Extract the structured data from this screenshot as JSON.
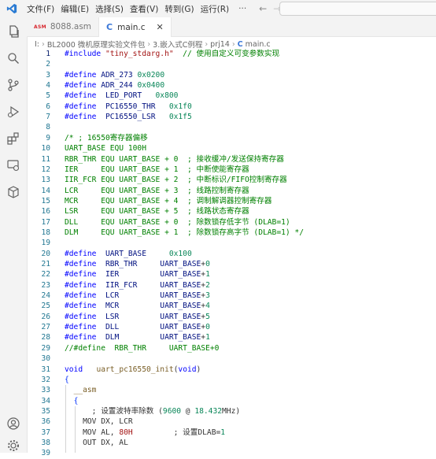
{
  "menu": [
    "文件(F)",
    "编辑(E)",
    "选择(S)",
    "查看(V)",
    "转到(G)",
    "运行(R)",
    "···"
  ],
  "tabs": [
    {
      "label": "8088.asm",
      "badge": "ASM",
      "active": false
    },
    {
      "label": "main.c",
      "badge": "C",
      "active": true
    }
  ],
  "breadcrumb": [
    "I:",
    "BL2000 微机原理实验文件包",
    "3.嵌入式C例程",
    "prj14",
    "main.c"
  ],
  "breadcrumb_file_badge": "C",
  "editor": {
    "lines": [
      {
        "n": "1",
        "t": [
          [
            "def",
            "#include "
          ],
          [
            "str",
            "\"tiny_stdarg.h\""
          ],
          [
            "cm",
            "  // 使用自定义可变参数实现"
          ]
        ]
      },
      {
        "n": "2",
        "t": []
      },
      {
        "n": "3",
        "t": [
          [
            "def",
            "#define "
          ],
          [
            "id",
            "ADR_273 "
          ],
          [
            "num",
            "0x0200"
          ]
        ]
      },
      {
        "n": "4",
        "t": [
          [
            "def",
            "#define "
          ],
          [
            "id",
            "ADR_244 "
          ],
          [
            "num",
            "0x0400"
          ]
        ]
      },
      {
        "n": "5",
        "t": [
          [
            "def",
            "#define  "
          ],
          [
            "id",
            "LED_PORT   "
          ],
          [
            "num",
            "0x800"
          ]
        ]
      },
      {
        "n": "6",
        "t": [
          [
            "def",
            "#define  "
          ],
          [
            "id",
            "PC16550_THR   "
          ],
          [
            "num",
            "0x1f0"
          ]
        ]
      },
      {
        "n": "7",
        "t": [
          [
            "def",
            "#define  "
          ],
          [
            "id",
            "PC16550_LSR   "
          ],
          [
            "num",
            "0x1f5"
          ]
        ]
      },
      {
        "n": "8",
        "t": []
      },
      {
        "n": "9",
        "t": [
          [
            "cm",
            "/* ; 16550寄存器偏移"
          ]
        ]
      },
      {
        "n": "10",
        "t": [
          [
            "cm",
            "UART_BASE EQU 100H"
          ]
        ]
      },
      {
        "n": "11",
        "t": [
          [
            "cm",
            "RBR_THR EQU UART_BASE + 0  ; 接收缓冲/发送保持寄存器"
          ]
        ]
      },
      {
        "n": "12",
        "t": [
          [
            "cm",
            "IER     EQU UART_BASE + 1  ; 中断使能寄存器"
          ]
        ]
      },
      {
        "n": "13",
        "t": [
          [
            "cm",
            "IIR_FCR EQU UART_BASE + 2  ; 中断标识/FIFO控制寄存器"
          ]
        ]
      },
      {
        "n": "14",
        "t": [
          [
            "cm",
            "LCR     EQU UART_BASE + 3  ; 线路控制寄存器"
          ]
        ]
      },
      {
        "n": "15",
        "t": [
          [
            "cm",
            "MCR     EQU UART_BASE + 4  ; 调制解调器控制寄存器"
          ]
        ]
      },
      {
        "n": "16",
        "t": [
          [
            "cm",
            "LSR     EQU UART_BASE + 5  ; 线路状态寄存器"
          ]
        ]
      },
      {
        "n": "17",
        "t": [
          [
            "cm",
            "DLL     EQU UART_BASE + 0  ; 除数锁存低字节 (DLAB=1)"
          ]
        ]
      },
      {
        "n": "18",
        "t": [
          [
            "cm",
            "DLM     EQU UART_BASE + 1  ; 除数锁存高字节 (DLAB=1) */"
          ]
        ]
      },
      {
        "n": "19",
        "t": []
      },
      {
        "n": "20",
        "t": [
          [
            "def",
            "#define  "
          ],
          [
            "id",
            "UART_BASE     "
          ],
          [
            "num",
            "0x100"
          ]
        ]
      },
      {
        "n": "21",
        "t": [
          [
            "def",
            "#define  "
          ],
          [
            "id",
            "RBR_THR     "
          ],
          [
            "id",
            "UART_BASE"
          ],
          [
            "plain",
            "+"
          ],
          [
            "num",
            "0"
          ]
        ]
      },
      {
        "n": "22",
        "t": [
          [
            "def",
            "#define  "
          ],
          [
            "id",
            "IER         "
          ],
          [
            "id",
            "UART_BASE"
          ],
          [
            "plain",
            "+"
          ],
          [
            "num",
            "1"
          ]
        ]
      },
      {
        "n": "23",
        "t": [
          [
            "def",
            "#define  "
          ],
          [
            "id",
            "IIR_FCR     "
          ],
          [
            "id",
            "UART_BASE"
          ],
          [
            "plain",
            "+"
          ],
          [
            "num",
            "2"
          ]
        ]
      },
      {
        "n": "24",
        "t": [
          [
            "def",
            "#define  "
          ],
          [
            "id",
            "LCR         "
          ],
          [
            "id",
            "UART_BASE"
          ],
          [
            "plain",
            "+"
          ],
          [
            "num",
            "3"
          ]
        ]
      },
      {
        "n": "25",
        "t": [
          [
            "def",
            "#define  "
          ],
          [
            "id",
            "MCR         "
          ],
          [
            "id",
            "UART_BASE"
          ],
          [
            "plain",
            "+"
          ],
          [
            "num",
            "4"
          ]
        ]
      },
      {
        "n": "26",
        "t": [
          [
            "def",
            "#define  "
          ],
          [
            "id",
            "LSR         "
          ],
          [
            "id",
            "UART_BASE"
          ],
          [
            "plain",
            "+"
          ],
          [
            "num",
            "5"
          ]
        ]
      },
      {
        "n": "27",
        "t": [
          [
            "def",
            "#define  "
          ],
          [
            "id",
            "DLL         "
          ],
          [
            "id",
            "UART_BASE"
          ],
          [
            "plain",
            "+"
          ],
          [
            "num",
            "0"
          ]
        ]
      },
      {
        "n": "28",
        "t": [
          [
            "def",
            "#define  "
          ],
          [
            "id",
            "DLM         "
          ],
          [
            "id",
            "UART_BASE"
          ],
          [
            "plain",
            "+"
          ],
          [
            "num",
            "1"
          ]
        ]
      },
      {
        "n": "29",
        "t": [
          [
            "cm",
            "//#define  RBR_THR     UART_BASE+0"
          ]
        ]
      },
      {
        "n": "30",
        "t": []
      },
      {
        "n": "31",
        "t": [
          [
            "kw",
            "void"
          ],
          [
            "plain",
            "   "
          ],
          [
            "fn",
            "uart_pc16550_init"
          ],
          [
            "plain",
            "("
          ],
          [
            "kw",
            "void"
          ],
          [
            "plain",
            ")"
          ]
        ]
      },
      {
        "n": "32",
        "t": [
          [
            "br",
            "{"
          ]
        ]
      },
      {
        "n": "33",
        "t": [
          [
            "plain",
            "  "
          ],
          [
            "fn",
            "__asm"
          ]
        ]
      },
      {
        "n": "34",
        "t": [
          [
            "plain",
            "  "
          ],
          [
            "br",
            "{"
          ]
        ]
      },
      {
        "n": "35",
        "t": [
          [
            "plain",
            "      ; 设置波特率除数 ("
          ],
          [
            "num",
            "9600"
          ],
          [
            "plain",
            " @ "
          ],
          [
            "num",
            "18.432"
          ],
          [
            "plain",
            "MHz)"
          ]
        ]
      },
      {
        "n": "36",
        "t": [
          [
            "plain",
            "    MOV DX, LCR"
          ]
        ]
      },
      {
        "n": "37",
        "t": [
          [
            "plain",
            "    MOV AL, "
          ],
          [
            "red",
            "80H"
          ],
          [
            "plain",
            "         ; 设置DLAB="
          ],
          [
            "num",
            "1"
          ]
        ]
      },
      {
        "n": "38",
        "t": [
          [
            "plain",
            "    OUT DX, AL"
          ]
        ]
      },
      {
        "n": "39",
        "t": []
      }
    ]
  }
}
